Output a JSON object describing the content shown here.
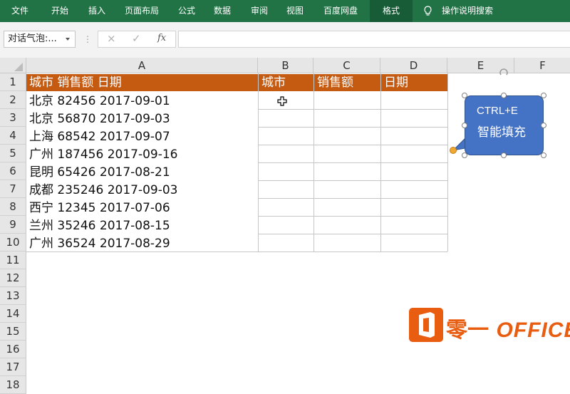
{
  "ribbon": {
    "tabs": [
      "文件",
      "开始",
      "插入",
      "页面布局",
      "公式",
      "数据",
      "审阅",
      "视图",
      "百度网盘",
      "格式"
    ],
    "active_tab": "格式",
    "search_label": "操作说明搜索",
    "color": "#217346"
  },
  "formula_bar": {
    "name_box": "对话气泡:...",
    "cancel_icon": "×",
    "enter_icon": "✓",
    "fx_label": "fx",
    "formula": ""
  },
  "sheet": {
    "columns": [
      "A",
      "B",
      "C",
      "D",
      "E",
      "F"
    ],
    "rows": [
      "1",
      "2",
      "3",
      "4",
      "5",
      "6",
      "7",
      "8",
      "9",
      "10",
      "11",
      "12",
      "13",
      "14",
      "15",
      "16",
      "17",
      "18"
    ],
    "header_color": "#c55a11",
    "header_row": {
      "A": "城市  销售额  日期",
      "B": "城市",
      "C": "销售额",
      "D": "日期"
    },
    "data_rows": [
      "北京  82456  2017-09-01",
      "北京  56870  2017-09-03",
      "上海  68542  2017-09-07",
      "广州  187456  2017-09-16",
      "昆明  65426  2017-08-21",
      "成都  235246  2017-09-03",
      "西宁  12345  2017-07-06",
      "兰州  35246  2017-08-15",
      "广州  36524  2017-08-29"
    ]
  },
  "callout": {
    "line1": "CTRL+E",
    "line2": "智能填充",
    "color": "#4472c4"
  },
  "watermark": {
    "cn": "零一",
    "en": "OFFICE",
    "color": "#e85d10"
  }
}
